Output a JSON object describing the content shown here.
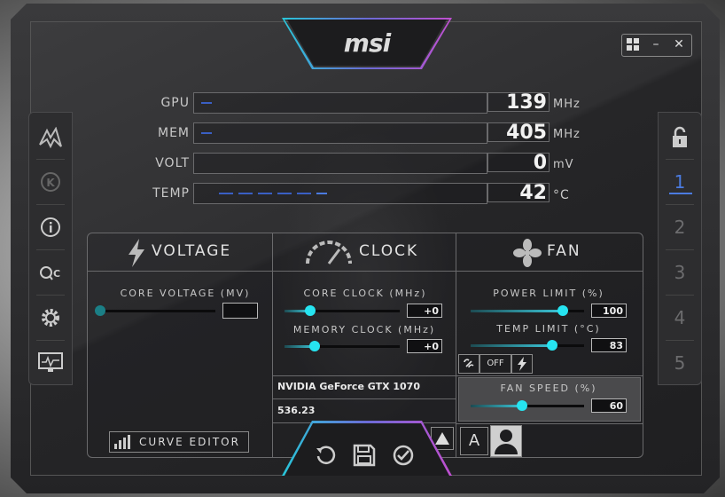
{
  "brand": "msi",
  "window_controls": {
    "windows": "windows-icon",
    "minimize": "–",
    "close": "✕"
  },
  "colors": {
    "accent_cyan": "#26e4f0",
    "profile_blue": "#4b7be0",
    "meter_dash": "#3a5fc4"
  },
  "left_sidebar": {
    "items": [
      {
        "name": "msi-dragon-logo-icon"
      },
      {
        "name": "kombustor-k-icon",
        "label": "K"
      },
      {
        "name": "info-icon"
      },
      {
        "name": "oc-scanner-icon",
        "label": "OC"
      },
      {
        "name": "settings-gear-icon"
      },
      {
        "name": "monitor-icon"
      }
    ]
  },
  "right_sidebar": {
    "lock": "lock-icon",
    "profiles": [
      "1",
      "2",
      "3",
      "4",
      "5"
    ],
    "active_profile": "1"
  },
  "meters": [
    {
      "label": "GPU",
      "value": "139",
      "unit": "MHz",
      "level": 0.03
    },
    {
      "label": "MEM",
      "value": "405",
      "unit": "MHz",
      "level": 0.03
    },
    {
      "label": "VOLT",
      "value": "0",
      "unit": "mV",
      "level": 0
    },
    {
      "label": "TEMP",
      "value": "42",
      "unit": "°C",
      "level": 0.42
    }
  ],
  "voltage": {
    "header": "VOLTAGE",
    "core_voltage_label": "CORE VOLTAGE  (MV)",
    "core_voltage_value": "",
    "core_voltage_level": 0,
    "curve_editor": "CURVE EDITOR"
  },
  "clock": {
    "header": "CLOCK",
    "core_clock_label": "CORE CLOCK (MHz)",
    "core_clock_value": "+0",
    "core_clock_level": 0.22,
    "memory_clock_label": "MEMORY CLOCK (MHz)",
    "memory_clock_value": "+0",
    "memory_clock_level": 0.26,
    "gpu_name": "NVIDIA GeForce GTX 1070",
    "driver_version": "536.23"
  },
  "fan": {
    "header": "FAN",
    "power_limit_label": "POWER LIMIT (%)",
    "power_limit_value": "100",
    "power_limit_level": 0.81,
    "temp_limit_label": "TEMP LIMIT (°C)",
    "temp_limit_value": "83",
    "temp_limit_level": 0.72,
    "link_toggle": "OFF",
    "fan_speed_label": "FAN SPEED (%)",
    "fan_speed_value": "60",
    "fan_speed_level": 0.45
  },
  "bottom": {
    "auto_label": "A",
    "reset": "reset-icon",
    "save": "save-icon",
    "apply": "apply-check-icon"
  }
}
